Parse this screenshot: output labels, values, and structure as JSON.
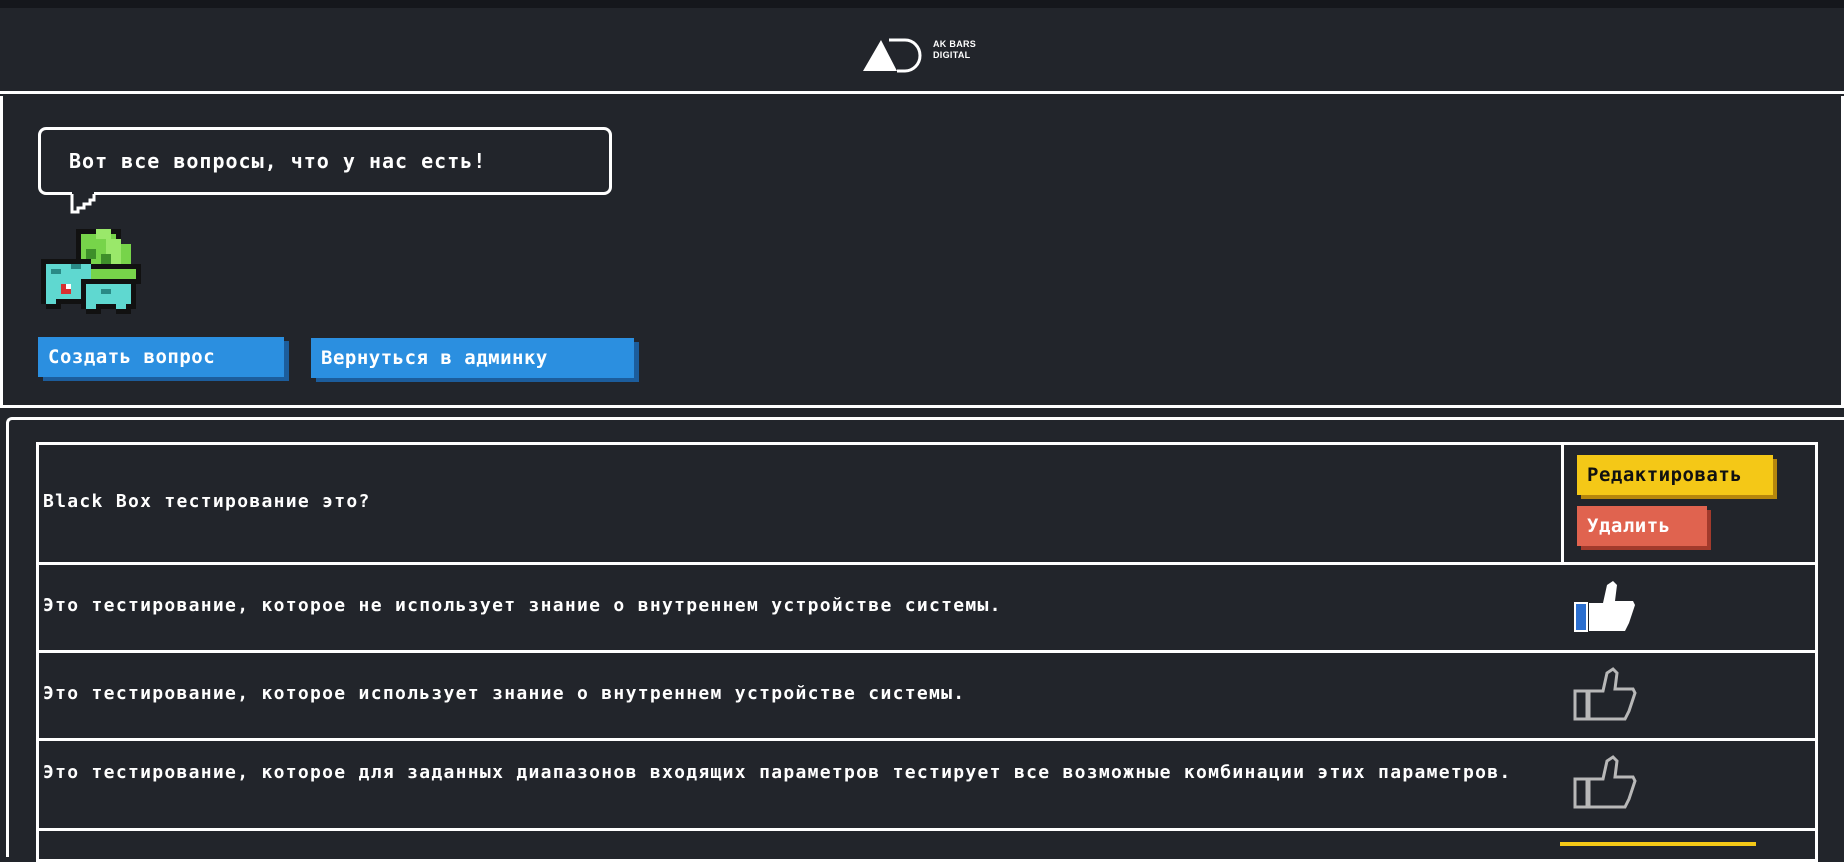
{
  "header": {
    "logo_text_line1": "AK BARS",
    "logo_text_line2": "DIGITAL"
  },
  "hero": {
    "speech_bubble": "Вот все вопросы, что у нас есть!",
    "create_button": "Создать вопрос",
    "back_button": "Вернуться в админку"
  },
  "questions": [
    {
      "question": "Black Box тестирование это?",
      "edit_label": "Редактировать",
      "delete_label": "Удалить",
      "answers": [
        {
          "text": "Это тестирование, которое не использует знание о внутреннем устройстве системы.",
          "correct": true,
          "icon": "thumbs-up-filled-icon"
        },
        {
          "text": "Это тестирование, которое использует знание о внутреннем устройстве системы.",
          "correct": false,
          "icon": "thumbs-up-outline-icon"
        },
        {
          "text": "Это тестирование, которое для заданных диапазонов входящих параметров тестирует все возможные комбинации этих параметров.",
          "correct": false,
          "icon": "thumbs-up-outline-icon"
        }
      ]
    }
  ],
  "colors": {
    "background": "#22252b",
    "border": "#ffffff",
    "primary_button": "#2b8fe0",
    "edit_button": "#f4c817",
    "delete_button": "#e0634f"
  }
}
